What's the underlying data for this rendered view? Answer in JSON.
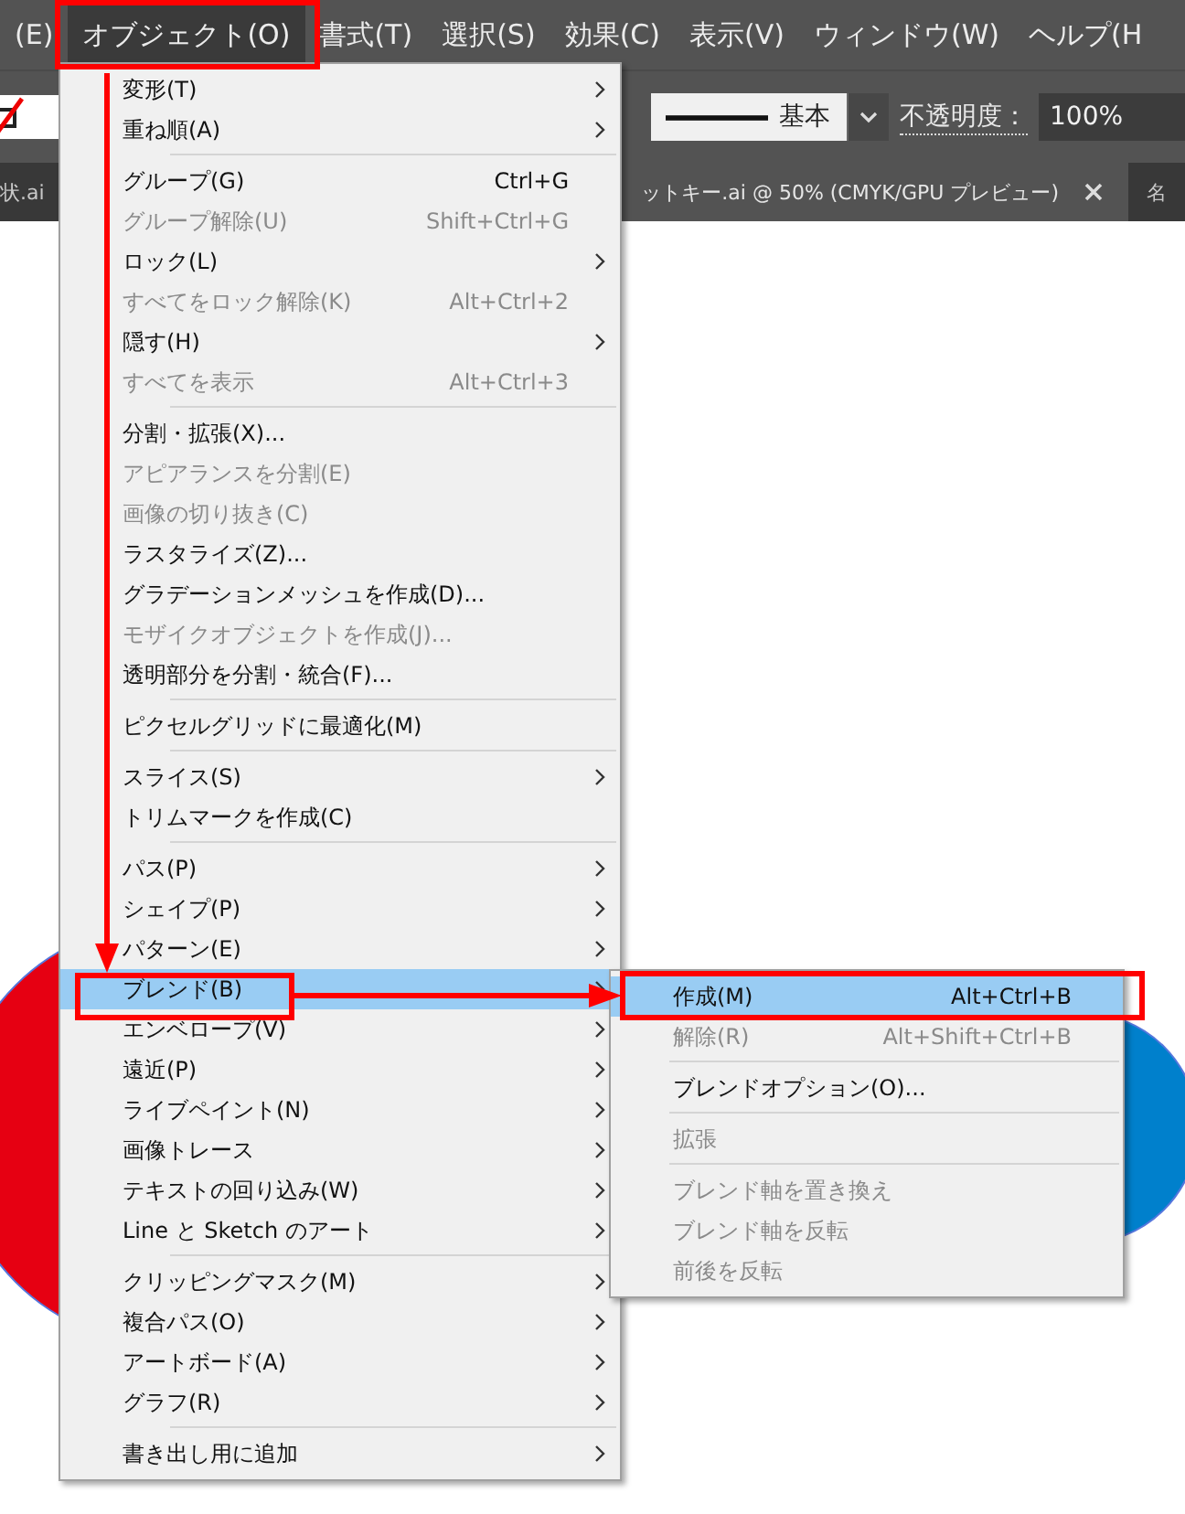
{
  "menubar": {
    "items": [
      {
        "label": "(E)",
        "selected": false
      },
      {
        "label": "オブジェクト(O)",
        "selected": true
      },
      {
        "label": "書式(T)",
        "selected": false
      },
      {
        "label": "選択(S)",
        "selected": false
      },
      {
        "label": "効果(C)",
        "selected": false
      },
      {
        "label": "表示(V)",
        "selected": false
      },
      {
        "label": "ウィンドウ(W)",
        "selected": false
      },
      {
        "label": "ヘルプ(H",
        "selected": false
      }
    ]
  },
  "toolbar": {
    "stroke_style": "基本",
    "opacity_label": "不透明度：",
    "opacity_value": "100%"
  },
  "tabs": [
    {
      "label": "状.ai",
      "selected": false,
      "closable": false
    },
    {
      "label": "ットキー.ai @ 50% (CMYK/GPU プレビュー)",
      "selected": true,
      "closable": true
    },
    {
      "label": "名",
      "selected": false,
      "closable": false
    }
  ],
  "object_menu": {
    "items": [
      {
        "kind": "item",
        "label": "変形(T)",
        "submenu": true,
        "disabled": false,
        "selected": false
      },
      {
        "kind": "item",
        "label": "重ね順(A)",
        "submenu": true,
        "disabled": false,
        "selected": false
      },
      {
        "kind": "separator"
      },
      {
        "kind": "item",
        "label": "グループ(G)",
        "shortcut": "Ctrl+G",
        "submenu": false,
        "disabled": false,
        "selected": false
      },
      {
        "kind": "item",
        "label": "グループ解除(U)",
        "shortcut": "Shift+Ctrl+G",
        "submenu": false,
        "disabled": true,
        "selected": false
      },
      {
        "kind": "item",
        "label": "ロック(L)",
        "submenu": true,
        "disabled": false,
        "selected": false
      },
      {
        "kind": "item",
        "label": "すべてをロック解除(K)",
        "shortcut": "Alt+Ctrl+2",
        "submenu": false,
        "disabled": true,
        "selected": false
      },
      {
        "kind": "item",
        "label": "隠す(H)",
        "submenu": true,
        "disabled": false,
        "selected": false
      },
      {
        "kind": "item",
        "label": "すべてを表示",
        "shortcut": "Alt+Ctrl+3",
        "submenu": false,
        "disabled": true,
        "selected": false
      },
      {
        "kind": "separator"
      },
      {
        "kind": "item",
        "label": "分割・拡張(X)...",
        "submenu": false,
        "disabled": false,
        "selected": false
      },
      {
        "kind": "item",
        "label": "アピアランスを分割(E)",
        "submenu": false,
        "disabled": true,
        "selected": false
      },
      {
        "kind": "item",
        "label": "画像の切り抜き(C)",
        "submenu": false,
        "disabled": true,
        "selected": false
      },
      {
        "kind": "item",
        "label": "ラスタライズ(Z)...",
        "submenu": false,
        "disabled": false,
        "selected": false
      },
      {
        "kind": "item",
        "label": "グラデーションメッシュを作成(D)...",
        "submenu": false,
        "disabled": false,
        "selected": false
      },
      {
        "kind": "item",
        "label": "モザイクオブジェクトを作成(J)...",
        "submenu": false,
        "disabled": true,
        "selected": false
      },
      {
        "kind": "item",
        "label": "透明部分を分割・統合(F)...",
        "submenu": false,
        "disabled": false,
        "selected": false
      },
      {
        "kind": "separator"
      },
      {
        "kind": "item",
        "label": "ピクセルグリッドに最適化(M)",
        "submenu": false,
        "disabled": false,
        "selected": false
      },
      {
        "kind": "separator"
      },
      {
        "kind": "item",
        "label": "スライス(S)",
        "submenu": true,
        "disabled": false,
        "selected": false
      },
      {
        "kind": "item",
        "label": "トリムマークを作成(C)",
        "submenu": false,
        "disabled": false,
        "selected": false
      },
      {
        "kind": "separator"
      },
      {
        "kind": "item",
        "label": "パス(P)",
        "submenu": true,
        "disabled": false,
        "selected": false
      },
      {
        "kind": "item",
        "label": "シェイプ(P)",
        "submenu": true,
        "disabled": false,
        "selected": false
      },
      {
        "kind": "item",
        "label": "パターン(E)",
        "submenu": true,
        "disabled": false,
        "selected": false
      },
      {
        "kind": "item",
        "label": "ブレンド(B)",
        "submenu": true,
        "disabled": false,
        "selected": true
      },
      {
        "kind": "item",
        "label": "エンベロープ(V)",
        "submenu": true,
        "disabled": false,
        "selected": false
      },
      {
        "kind": "item",
        "label": "遠近(P)",
        "submenu": true,
        "disabled": false,
        "selected": false
      },
      {
        "kind": "item",
        "label": "ライブペイント(N)",
        "submenu": true,
        "disabled": false,
        "selected": false
      },
      {
        "kind": "item",
        "label": "画像トレース",
        "submenu": true,
        "disabled": false,
        "selected": false
      },
      {
        "kind": "item",
        "label": "テキストの回り込み(W)",
        "submenu": true,
        "disabled": false,
        "selected": false
      },
      {
        "kind": "item",
        "label": "Line と Sketch のアート",
        "submenu": true,
        "disabled": false,
        "selected": false
      },
      {
        "kind": "separator"
      },
      {
        "kind": "item",
        "label": "クリッピングマスク(M)",
        "submenu": true,
        "disabled": false,
        "selected": false
      },
      {
        "kind": "item",
        "label": "複合パス(O)",
        "submenu": true,
        "disabled": false,
        "selected": false
      },
      {
        "kind": "item",
        "label": "アートボード(A)",
        "submenu": true,
        "disabled": false,
        "selected": false
      },
      {
        "kind": "item",
        "label": "グラフ(R)",
        "submenu": true,
        "disabled": false,
        "selected": false
      },
      {
        "kind": "separator"
      },
      {
        "kind": "item",
        "label": "書き出し用に追加",
        "submenu": true,
        "disabled": false,
        "selected": false
      }
    ]
  },
  "blend_submenu": {
    "items": [
      {
        "kind": "item",
        "label": "作成(M)",
        "shortcut": "Alt+Ctrl+B",
        "submenu": false,
        "disabled": false,
        "selected": true
      },
      {
        "kind": "item",
        "label": "解除(R)",
        "shortcut": "Alt+Shift+Ctrl+B",
        "submenu": false,
        "disabled": true,
        "selected": false
      },
      {
        "kind": "separator"
      },
      {
        "kind": "item",
        "label": "ブレンドオプション(O)...",
        "submenu": false,
        "disabled": false,
        "selected": false
      },
      {
        "kind": "separator"
      },
      {
        "kind": "item",
        "label": "拡張",
        "submenu": false,
        "disabled": true,
        "selected": false
      },
      {
        "kind": "separator"
      },
      {
        "kind": "item",
        "label": "ブレンド軸を置き換え",
        "submenu": false,
        "disabled": true,
        "selected": false
      },
      {
        "kind": "item",
        "label": "ブレンド軸を反転",
        "submenu": false,
        "disabled": true,
        "selected": false
      },
      {
        "kind": "item",
        "label": "前後を反転",
        "submenu": false,
        "disabled": true,
        "selected": false
      }
    ]
  }
}
